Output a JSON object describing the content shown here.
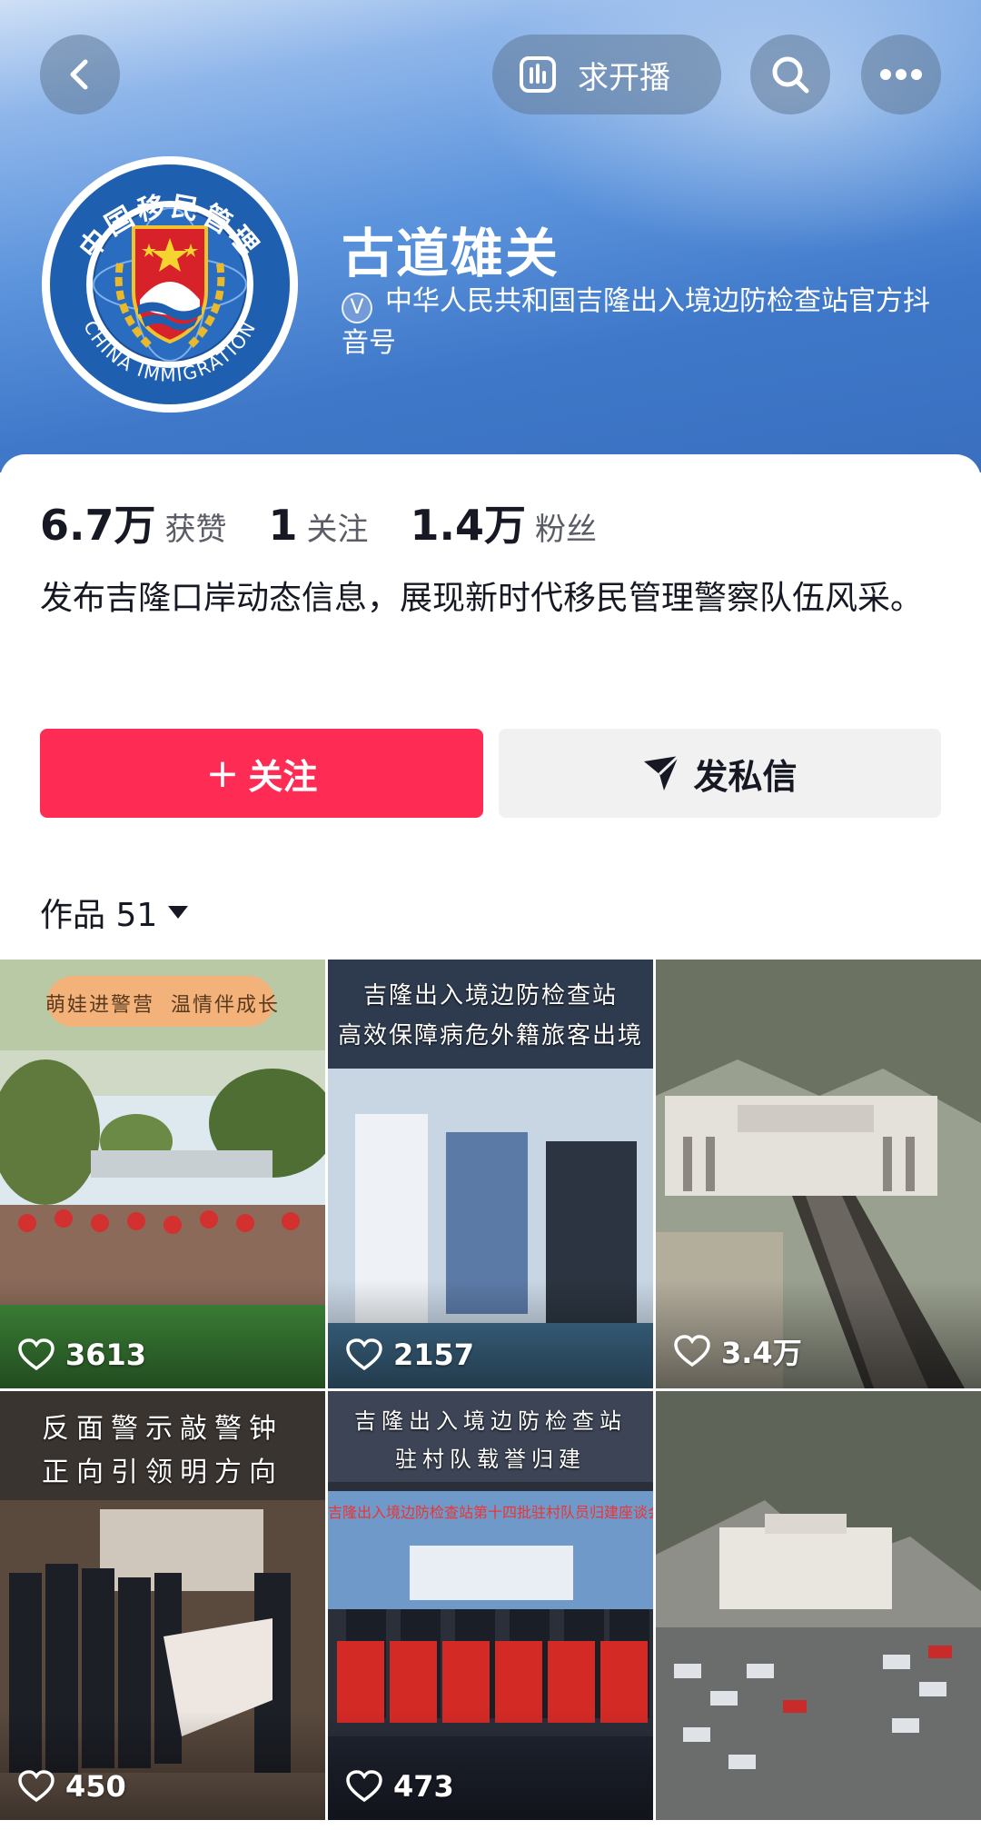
{
  "header": {
    "live_request_label": "求开播",
    "account_name": "古道雄关",
    "verify_badge": "V",
    "verification_text": "中华人民共和国吉隆出入境边防检查站官方抖音号",
    "logo_text_top": "中国移民管理",
    "logo_text_bottom": "CHINA IMMIGRATION"
  },
  "stats": {
    "likes_value": "6.7万",
    "likes_label": "获赞",
    "following_value": "1",
    "following_label": "关注",
    "followers_value": "1.4万",
    "followers_label": "粉丝"
  },
  "bio": "发布吉隆口岸动态信息，展现新时代移民管理警察队伍风采。",
  "actions": {
    "follow_label": "关注",
    "follow_plus": "+",
    "message_label": "发私信"
  },
  "works": {
    "tab_label": "作品 51"
  },
  "videos": [
    {
      "likes": "3613",
      "caption": [
        "萌娃进警营",
        "温情伴成长"
      ]
    },
    {
      "likes": "2157",
      "caption": [
        "吉隆出入境边防检查站",
        "高效保障病危外籍旅客出境"
      ]
    },
    {
      "likes": "3.4万",
      "caption": []
    },
    {
      "likes": "450",
      "caption": [
        "反面警示敲警钟",
        "正向引领明方向"
      ]
    },
    {
      "likes": "473",
      "caption": [
        "吉隆出入境边防检查站",
        "驻村队载誉归建",
        "吉隆出入境边防检查站第十四批驻村队员归建座谈会"
      ]
    },
    {
      "likes": "",
      "caption": []
    }
  ],
  "colors": {
    "follow_button": "#fe2c55",
    "message_button": "#f1f1f2",
    "header_blue": "#3f78c9"
  }
}
